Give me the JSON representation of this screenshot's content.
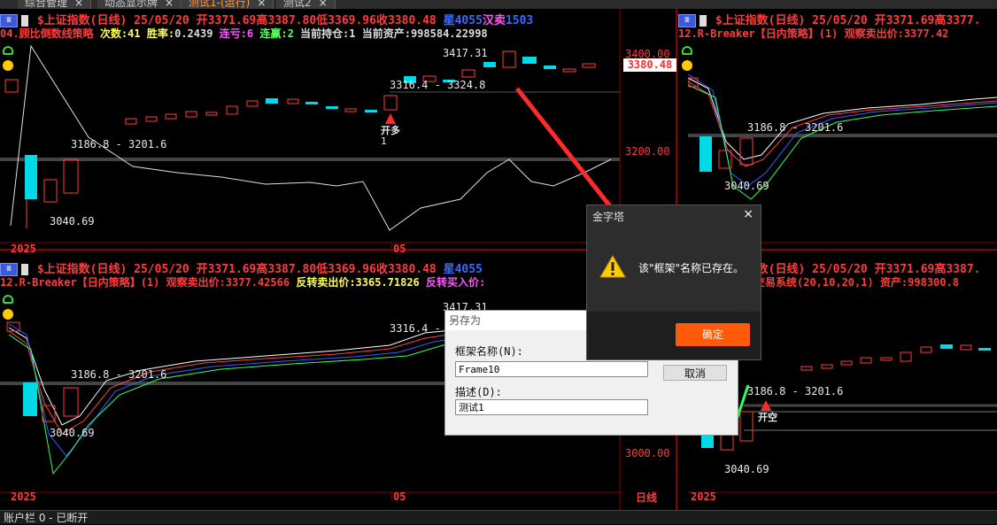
{
  "tabs": [
    {
      "label": "综合管理",
      "active": false
    },
    {
      "label": "动态显示牌",
      "active": false
    },
    {
      "label": "测试1-(运行)",
      "active": true
    },
    {
      "label": "测试2",
      "active": false
    }
  ],
  "close_glyph": "×",
  "panels": {
    "top_left": {
      "header1": {
        "symbol": "$上证指数(日线) 25/05/20",
        "open": "开3371.69",
        "high": "高3387.80",
        "low": "低3369.96",
        "close": "收3380.48",
        "tag1": "星",
        "tag2": "4055",
        "tag3": "汉",
        "tag4": "卖",
        "tag5": "1503"
      },
      "header2": {
        "strategy": "04.顾比倒数线策略",
        "count": "次数:41",
        "winrate_label": "胜率:",
        "winrate": "0.2439",
        "streak_loss": "连亏:6",
        "streak_win": "连赢:2",
        "position": "当前持仓:1",
        "assets": "当前资产:998584.22998"
      },
      "prices": {
        "hi_label": "3417.31",
        "mid_label": "3316.4 - 3324.8",
        "sup_label": "3186.8 - 3201.6",
        "low_label": "3040.69",
        "signal": "开多",
        "signal_count": "1"
      },
      "x_labels": [
        "2025",
        "05"
      ]
    },
    "top_right": {
      "header1": {
        "symbol": "$上证指数(日线) 25/05/20",
        "open": "开3371.69",
        "high": "高3377."
      },
      "header2": {
        "strategy": "12.R-Breaker【日内策略】(1) 观察卖出价:3377.42"
      },
      "prices": {
        "sup_label": "3186.8 - 3201.6",
        "low_label": "3040.69"
      },
      "x_labels": [
        "2025"
      ]
    },
    "bottom_left": {
      "header1": {
        "symbol": "$上证指数(日线) 25/05/20",
        "open": "开3371.69",
        "high": "高3387.80",
        "low": "低3369.96",
        "close": "收3380.48",
        "tag1": "星",
        "tag2": "4055"
      },
      "header2": {
        "strategy": "12.R-Breaker【日内策略】(1) 观察卖出价:3377.42566",
        "rev_sell": "反转卖出价:3365.71826",
        "rev_buy": "反转买入价:"
      },
      "prices": {
        "hi_label": "3417.31",
        "mid_label": "3316.4 -",
        "sup_label": "3186.8 - 3201.6",
        "low_label": "3040.69"
      },
      "x_labels": [
        "2025",
        "05"
      ]
    },
    "bottom_right": {
      "header1": {
        "symbol": "$上证指数(日线) 25/05/20",
        "open": "开3371.69",
        "high": "高3387."
      },
      "header2": {
        "strategy": "交易系统(20,10,20,1) 资产:998300.8"
      },
      "prices": {
        "sup_label": "3186.8 - 3201.6",
        "low_label": "3040.69",
        "signal": "开空"
      },
      "x_labels": [
        "2025"
      ]
    }
  },
  "y_axis": {
    "current_price": "3380.48",
    "ticks_top": [
      "3400.00",
      "3200.00"
    ],
    "ticks_bottom": [
      "3000.00"
    ],
    "period": "日线"
  },
  "save_dialog": {
    "title": "另存为",
    "name_label": "框架名称(N):",
    "name_value": "Frame10",
    "desc_label": "描述(D):",
    "desc_value": "测试1",
    "cancel_label": "取消"
  },
  "alert_dialog": {
    "title": "金字塔",
    "message": "该\"框架\"名称已存在。",
    "ok_label": "确定",
    "close_glyph": "×"
  },
  "status": {
    "text": "账户栏 0 - 已断开"
  },
  "colors": {
    "up": "#ff3b3b",
    "down": "#00d9e8",
    "arrow": "#ff2a2a",
    "accent_button": "#ff5a0a"
  }
}
